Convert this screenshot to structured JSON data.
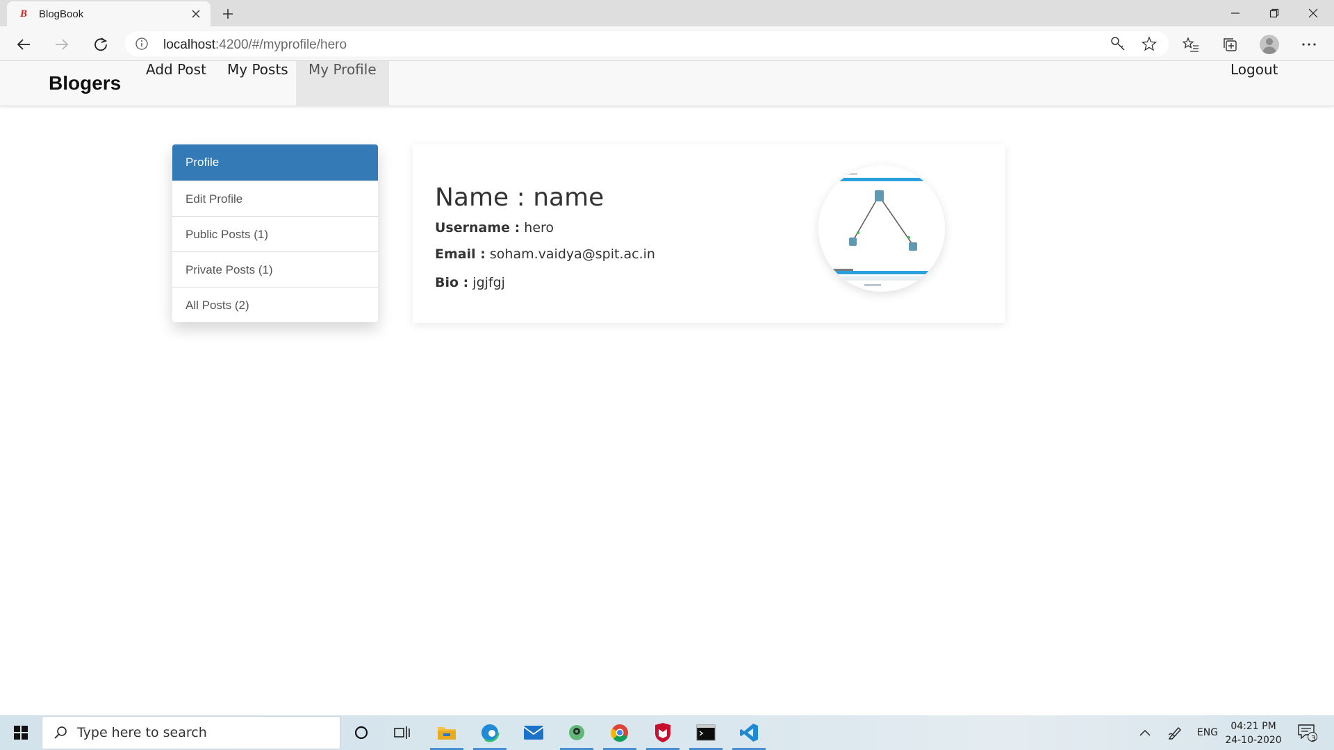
{
  "browser": {
    "tab_title": "BlogBook",
    "tab_favicon_letter": "B",
    "url_host": "localhost",
    "url_path": ":4200/#/myprofile/hero",
    "icons": [
      "back-icon",
      "forward-icon",
      "refresh-icon",
      "info-icon",
      "key-icon",
      "star-icon",
      "favorites-icon",
      "collections-icon",
      "profile-avatar",
      "more-icon",
      "minimize-icon",
      "restore-icon",
      "close-icon",
      "plus-icon"
    ]
  },
  "navbar": {
    "brand": "Blogers",
    "links": [
      "Add Post",
      "My Posts",
      "My Profile"
    ],
    "active_link": "My Profile",
    "logout": "Logout"
  },
  "sidebar": {
    "items": [
      "Profile",
      "Edit Profile",
      "Public Posts (1)",
      "Private Posts (1)",
      "All Posts (2)"
    ],
    "active_item": "Profile",
    "active_color": "#337ab7"
  },
  "profile": {
    "name_label": "Name : ",
    "name": "name",
    "username_label": "Username :",
    "username": "hero",
    "email_label": "Email :",
    "email": "soham.vaidya@spit.ac.in",
    "bio_label": "Bio :",
    "bio": "jgjfgj"
  },
  "taskbar": {
    "search_placeholder": "Type here to search",
    "apps": [
      "cortana-icon",
      "task-view-icon",
      "file-explorer-icon",
      "edge-icon",
      "mail-icon",
      "maps-icon",
      "chrome-icon",
      "mcafee-icon",
      "terminal-icon",
      "vscode-icon"
    ],
    "lang": "ENG",
    "time": "04:21 PM",
    "date": "24-10-2020",
    "notification_count": "3"
  }
}
